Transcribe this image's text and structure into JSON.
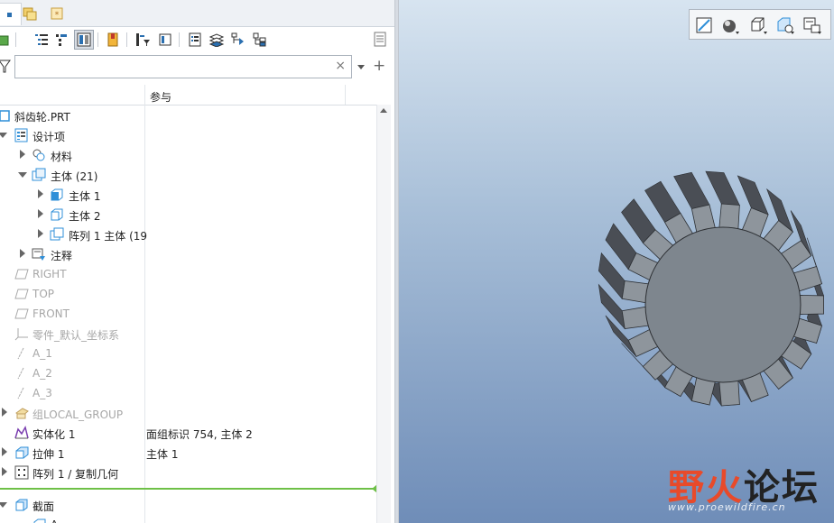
{
  "search": {
    "placeholder": "",
    "clear_glyph": "×",
    "add_glyph": "+"
  },
  "columns": {
    "reference": "参与"
  },
  "tree": [
    {
      "label": "斜齿轮.PRT",
      "ref": "",
      "icon": "part-icon",
      "dim": false
    },
    {
      "label": "设计项",
      "ref": "",
      "icon": "design-items-icon",
      "dim": false
    },
    {
      "label": "材料",
      "ref": "",
      "icon": "material-icon",
      "dim": false
    },
    {
      "label": "主体 (21)",
      "ref": "",
      "icon": "bodies-icon",
      "dim": false
    },
    {
      "label": "主体 1",
      "ref": "",
      "icon": "body-icon",
      "dim": false
    },
    {
      "label": "主体 2",
      "ref": "",
      "icon": "body-icon",
      "dim": false
    },
    {
      "label": "阵列 1 主体 (19",
      "ref": "",
      "icon": "pattern-body-icon",
      "dim": false
    },
    {
      "label": "注释",
      "ref": "",
      "icon": "annotation-icon",
      "dim": false
    },
    {
      "label": "RIGHT",
      "ref": "",
      "icon": "datum-plane-icon",
      "dim": true
    },
    {
      "label": "TOP",
      "ref": "",
      "icon": "datum-plane-icon",
      "dim": true
    },
    {
      "label": "FRONT",
      "ref": "",
      "icon": "datum-plane-icon",
      "dim": true
    },
    {
      "label": "零件_默认_坐标系",
      "ref": "",
      "icon": "coordinate-system-icon",
      "dim": true
    },
    {
      "label": "A_1",
      "ref": "",
      "icon": "datum-axis-icon",
      "dim": true
    },
    {
      "label": "A_2",
      "ref": "",
      "icon": "datum-axis-icon",
      "dim": true
    },
    {
      "label": "A_3",
      "ref": "",
      "icon": "datum-axis-icon",
      "dim": true
    },
    {
      "label": "组LOCAL_GROUP",
      "ref": "",
      "icon": "group-icon",
      "dim": true
    },
    {
      "label": "实体化 1",
      "ref": "面组标识 754, 主体 2",
      "icon": "solidify-icon",
      "dim": false
    },
    {
      "label": "拉伸 1",
      "ref": "主体 1",
      "icon": "extrude-icon",
      "dim": false
    },
    {
      "label": "阵列 1 / 复制几何",
      "ref": "",
      "icon": "pattern-icon",
      "dim": false
    },
    {
      "label": "截面",
      "ref": "",
      "icon": "section-icon",
      "dim": false
    },
    {
      "label": "A",
      "ref": "",
      "icon": "section-item-icon",
      "dim": false
    }
  ],
  "watermark": {
    "text_part1": "野火",
    "text_part2": "论坛",
    "url": "www.proewildfire.cn",
    "color1": "#e84a2a",
    "color2": "#222222"
  },
  "colors": {
    "accent": "#2f8fd8",
    "insert_line": "#6ec047"
  }
}
